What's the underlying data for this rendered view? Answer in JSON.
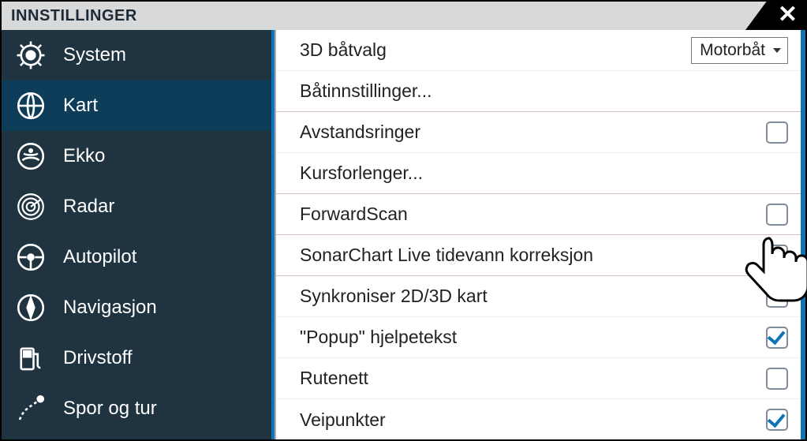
{
  "title": "INNSTILLINGER",
  "sidebar": {
    "items": [
      {
        "label": "System"
      },
      {
        "label": "Kart"
      },
      {
        "label": "Ekko"
      },
      {
        "label": "Radar"
      },
      {
        "label": "Autopilot"
      },
      {
        "label": "Navigasjon"
      },
      {
        "label": "Drivstoff"
      },
      {
        "label": "Spor og tur"
      }
    ]
  },
  "content": {
    "boat3d_label": "3D båtvalg",
    "boat3d_value": "Motorbåt",
    "boatsettings": "Båtinnstillinger...",
    "rangerings": "Avstandsringer",
    "courseext": "Kursforlenger...",
    "forwardscan": "ForwardScan",
    "sonarchart": "SonarChart Live tidevann korreksjon",
    "sync2d3d": "Synkroniser 2D/3D kart",
    "popup": "\"Popup\" hjelpetekst",
    "grid": "Rutenett",
    "waypoints": "Veipunkter"
  }
}
